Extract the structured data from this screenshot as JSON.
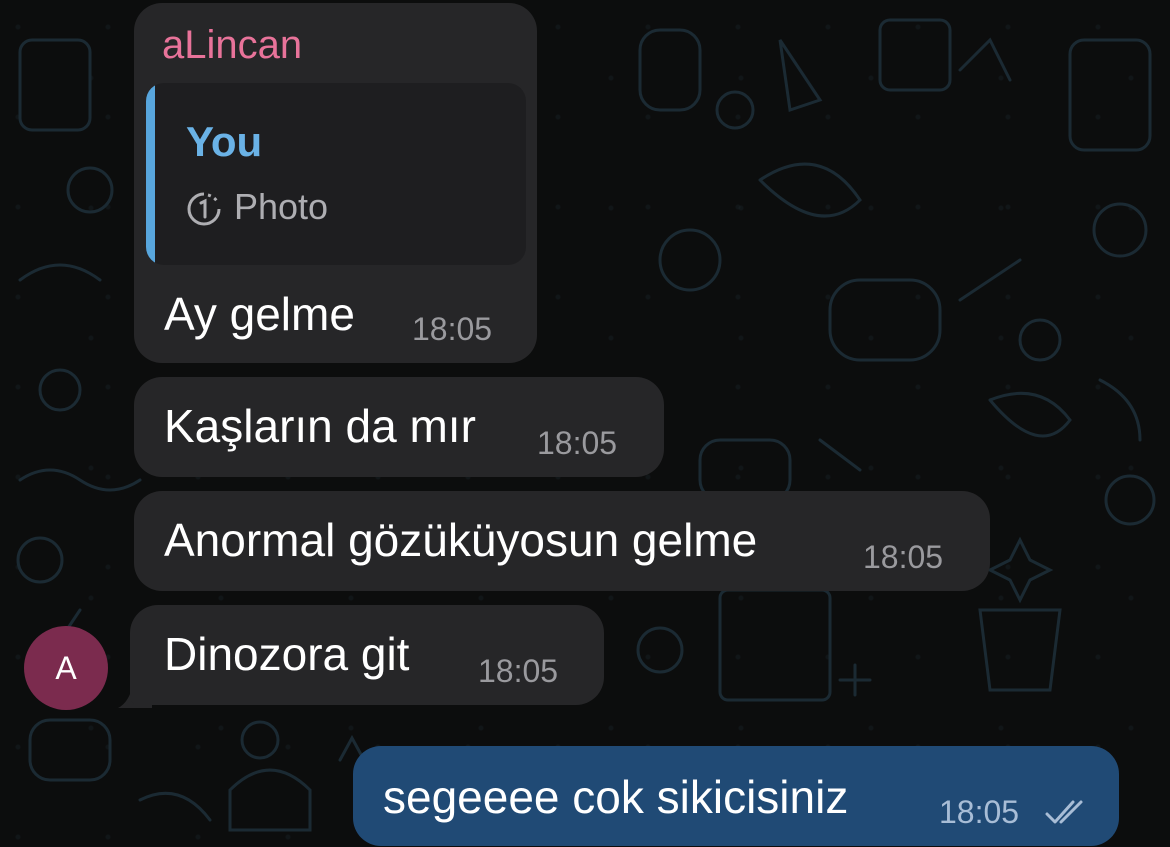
{
  "chat": {
    "messages": [
      {
        "sender": "aLincan",
        "reply": {
          "author": "You",
          "label": "Photo",
          "icon": "view-once-icon"
        },
        "text": "Ay gelme",
        "time": "18:05"
      },
      {
        "text": "Kaşların da mır",
        "time": "18:05"
      },
      {
        "text": "Anormal gözüküyosun gelme",
        "time": "18:05"
      },
      {
        "text": "Dinozora git",
        "time": "18:05",
        "avatar_letter": "A"
      }
    ],
    "outgoing": {
      "text": "segeeee cok sikicisiniz",
      "time": "18:05",
      "status_icon": "double-check-icon"
    }
  },
  "colors": {
    "background": "#0c0d0d",
    "incoming_bubble": "#262628",
    "outgoing_bubble": "#204a75",
    "sender_name": "#e8739a",
    "reply_accent": "#58a6dd",
    "avatar": "#7b2b4e"
  }
}
